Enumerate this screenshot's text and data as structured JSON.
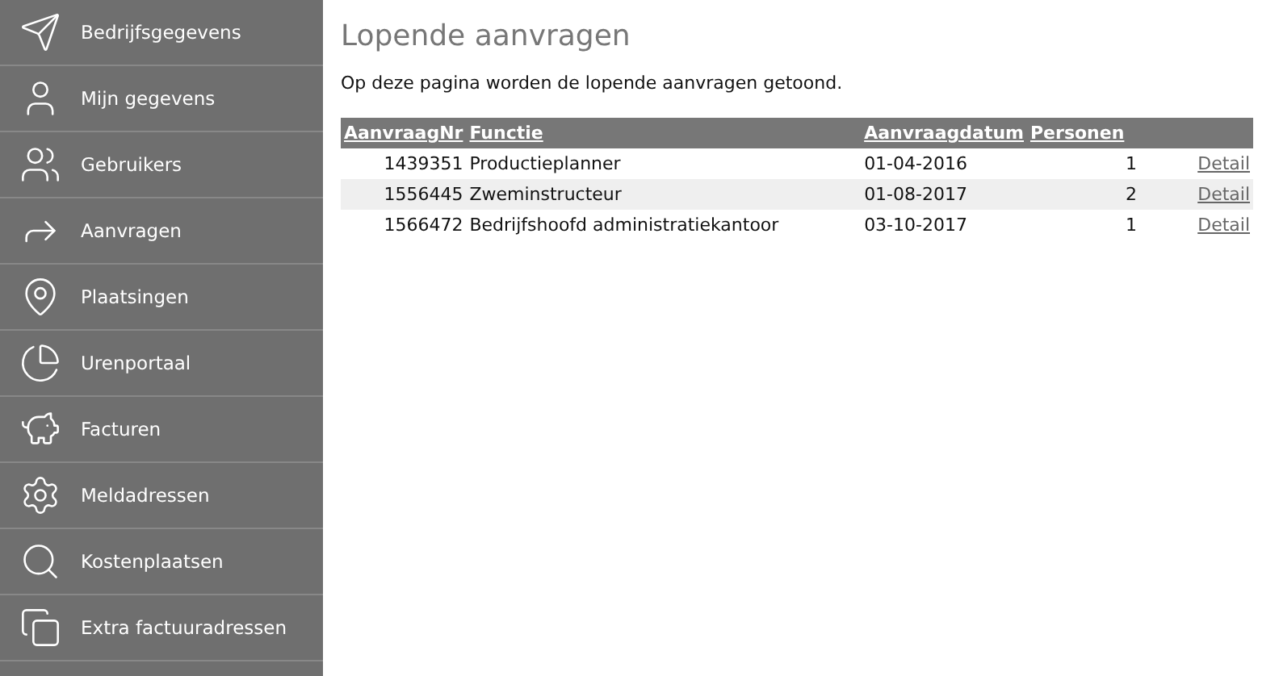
{
  "sidebar": {
    "items": [
      {
        "label": "Bedrijfsgegevens"
      },
      {
        "label": "Mijn gegevens"
      },
      {
        "label": "Gebruikers"
      },
      {
        "label": "Aanvragen"
      },
      {
        "label": "Plaatsingen"
      },
      {
        "label": "Urenportaal"
      },
      {
        "label": "Facturen"
      },
      {
        "label": "Meldadressen"
      },
      {
        "label": "Kostenplaatsen"
      },
      {
        "label": "Extra factuuradressen"
      }
    ]
  },
  "page": {
    "title": "Lopende aanvragen",
    "intro": "Op deze pagina worden de lopende aanvragen getoond."
  },
  "table": {
    "columns": [
      "AanvraagNr",
      "Functie",
      "Aanvraagdatum",
      "Personen"
    ],
    "rows": [
      {
        "nr": "1439351",
        "functie": "Productieplanner",
        "datum": "01-04-2016",
        "personen": "1",
        "link": "Detail"
      },
      {
        "nr": "1556445",
        "functie": "Zweminstructeur",
        "datum": "01-08-2017",
        "personen": "2",
        "link": "Detail"
      },
      {
        "nr": "1566472",
        "functie": "Bedrijfshoofd administratiekantoor",
        "datum": "03-10-2017",
        "personen": "1",
        "link": "Detail"
      }
    ]
  }
}
